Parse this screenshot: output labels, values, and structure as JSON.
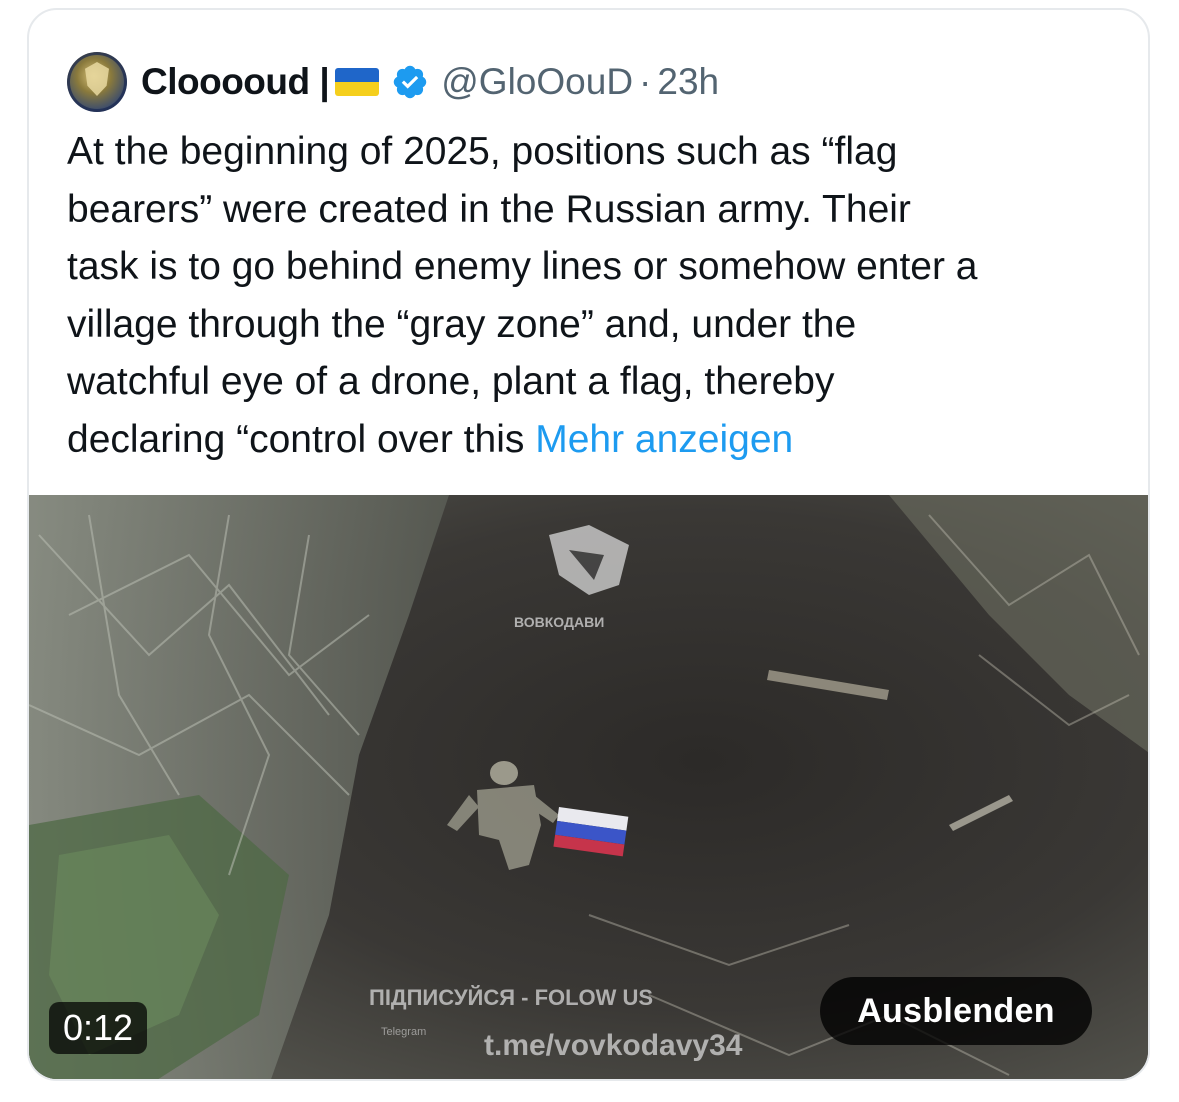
{
  "tweet": {
    "display_name": "Clooooud |",
    "flag_icon": "ukraine-flag-emoji",
    "verified_icon": "verified-badge-icon",
    "handle": "@GloOouD",
    "separator": "·",
    "time": "23h",
    "text_lines": [
      "At the beginning of 2025, positions such as “flag",
      "bearers” were created in the Russian army. Their",
      "task is to go behind enemy lines or somehow enter a",
      "village through the “gray zone” and, under the",
      "watchful eye of a drone, plant a flag, thereby",
      "declaring “control over this "
    ],
    "show_more_label": "Mehr anzeigen"
  },
  "media": {
    "duration": "0:12",
    "hide_label": "Ausblenden",
    "watermark_top": "ВОВКОДАВИ",
    "watermark_bottom_line1": "ПІДПИСУЙСЯ - FOLOW US",
    "watermark_bottom_line2": "t.me/vovkodavy34",
    "watermark_side": "Telegram"
  },
  "colors": {
    "link": "#1d9bf0",
    "text": "#0f1419",
    "muted": "#536471",
    "verified": "#1d9bf0",
    "flag_blue": "#1f66c9",
    "flag_yellow": "#f5cf1d"
  }
}
